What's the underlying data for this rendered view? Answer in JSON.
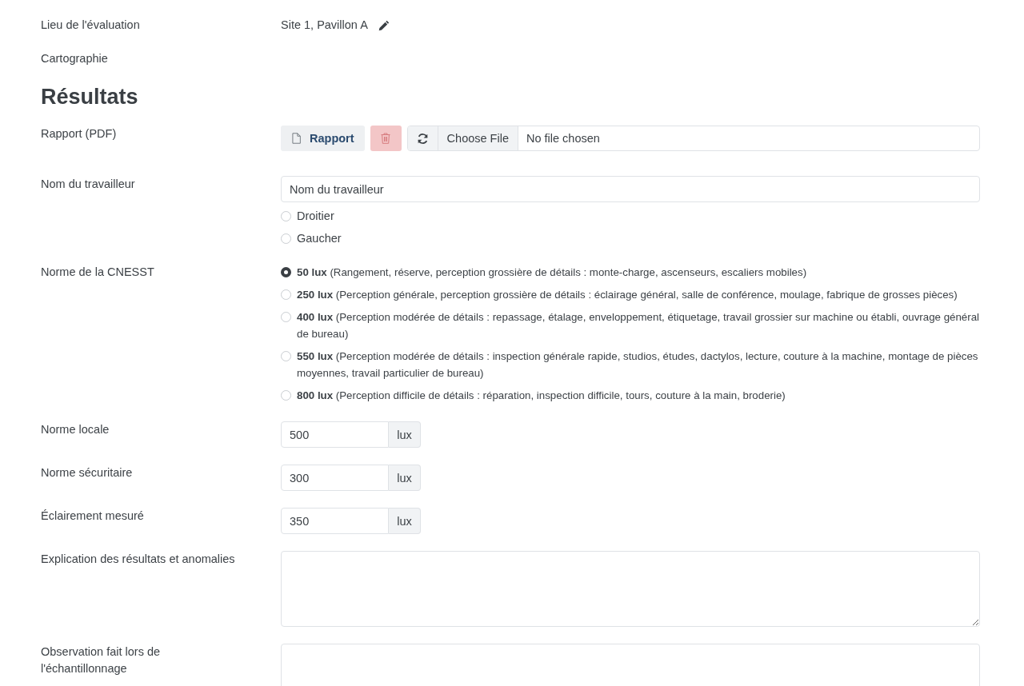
{
  "fields": [
    {
      "kind": "text",
      "label": "Lieu de l'évaluation",
      "value": "Site 1, Pavillon A"
    },
    {
      "kind": "plain",
      "label": "Cartographie"
    },
    {
      "kind": "heading",
      "label": "Résultats"
    },
    {
      "kind": "file",
      "label": "Rapport (PDF)",
      "report_button": "Rapport",
      "choose_button": "Choose File",
      "file_status": "No file chosen"
    },
    {
      "kind": "name",
      "label": "Nom du travailleur",
      "value": "Nom du travailleur",
      "options": [
        {
          "label": "Droitier",
          "selected": false
        },
        {
          "label": "Gaucher",
          "selected": false
        }
      ]
    },
    {
      "kind": "radio",
      "label": "Norme de la CNESST",
      "options": [
        {
          "label": "**50 lux** (Rangement, réserve, perception grossière de détails : monte-charge, ascenseurs, escaliers mobiles)",
          "selected": true
        },
        {
          "label": "**250 lux** (Perception générale, perception grossière de détails : éclairage général, salle de conférence, moulage, fabrique de grosses pièces)",
          "selected": false
        },
        {
          "label": "**400 lux** (Perception modérée de détails : repassage, étalage, enveloppement, étiquetage, travail grossier sur machine ou établi, ouvrage général de bureau)",
          "selected": false
        },
        {
          "label": "**550 lux** (Perception modérée de détails : inspection générale rapide, studios, études, dactylos, lecture, couture à la machine, montage de pièces moyennes, travail particulier de bureau)",
          "selected": false
        },
        {
          "label": "**800 lux** (Perception difficile de détails : réparation, inspection difficile, tours, couture à la main, broderie)",
          "selected": false
        }
      ]
    },
    {
      "kind": "unit",
      "label": "Norme locale",
      "value": "500",
      "unit": "lux"
    },
    {
      "kind": "unit",
      "label": "Norme sécuritaire",
      "value": "300",
      "unit": "lux"
    },
    {
      "kind": "unit",
      "label": "Éclairement mesuré",
      "value": "350",
      "unit": "lux"
    },
    {
      "kind": "textarea",
      "label": "Explication des résultats et anomalies"
    },
    {
      "kind": "textarea",
      "label": "Observation fait lors de l'échantillonnage"
    }
  ]
}
